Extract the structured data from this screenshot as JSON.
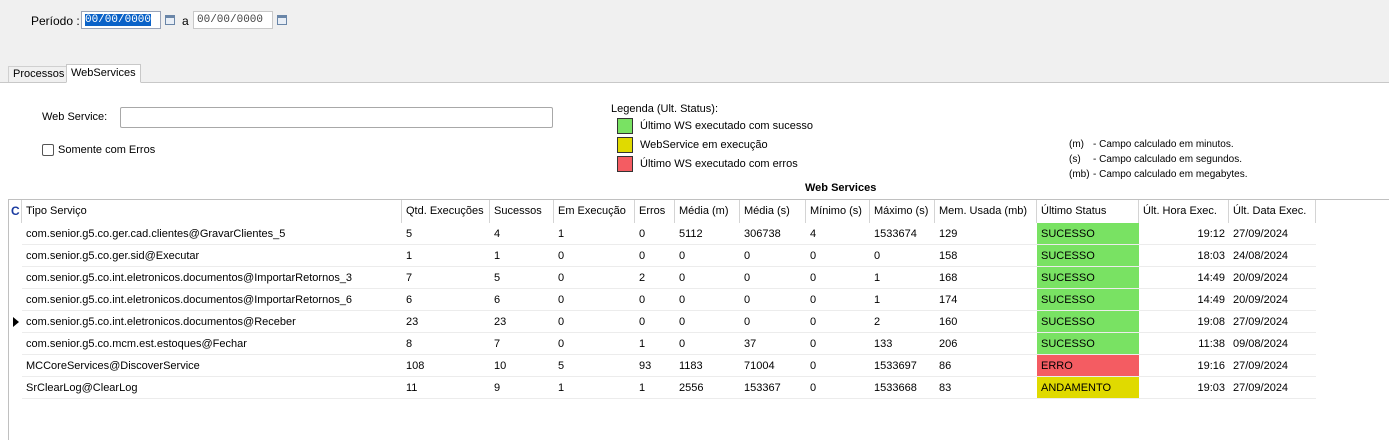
{
  "filter": {
    "period_label": "Período :",
    "date_from": "00/00/0000",
    "separator": "a",
    "date_to": "00/00/0000"
  },
  "tabs": [
    {
      "label": "Processos",
      "active": false
    },
    {
      "label": "WebServices",
      "active": true
    }
  ],
  "form": {
    "web_service_label": "Web Service:",
    "web_service_value": "",
    "only_errors_label": "Somente com Erros",
    "only_errors_checked": false
  },
  "legend": {
    "title": "Legenda (Ult. Status):",
    "items": [
      {
        "label": "Último WS executado com sucesso",
        "color": "#79e263"
      },
      {
        "label": "WebService em execução",
        "color": "#e0da00"
      },
      {
        "label": "Último WS executado com erros",
        "color": "#f45c62"
      }
    ]
  },
  "notes": [
    {
      "unit": "(m)",
      "text": "- Campo calculado em minutos."
    },
    {
      "unit": "(s)",
      "text": "- Campo calculado em segundos."
    },
    {
      "unit": "(mb)",
      "text": "- Campo calculado em megabytes."
    }
  ],
  "grid": {
    "title": "Web Services",
    "corner": "C",
    "columns": [
      "Tipo Serviço",
      "Qtd. Execuções",
      "Sucessos",
      "Em Execução",
      "Erros",
      "Média (m)",
      "Média (s)",
      "Mínimo (s)",
      "Máximo (s)",
      "Mem. Usada (mb)",
      "Último Status",
      "Últ. Hora Exec.",
      "Últ. Data Exec."
    ],
    "status_colors": {
      "SUCESSO": "#79e263",
      "ERRO": "#f45c62",
      "ANDAMENTO": "#e0da00"
    },
    "current_row": 4,
    "rows": [
      [
        "com.senior.g5.co.ger.cad.clientes@GravarClientes_5",
        "5",
        "4",
        "1",
        "0",
        "5112",
        "306738",
        "4",
        "1533674",
        "129",
        "SUCESSO",
        "19:12",
        "27/09/2024"
      ],
      [
        "com.senior.g5.co.ger.sid@Executar",
        "1",
        "1",
        "0",
        "0",
        "0",
        "0",
        "0",
        "0",
        "158",
        "SUCESSO",
        "18:03",
        "24/08/2024"
      ],
      [
        "com.senior.g5.co.int.eletronicos.documentos@ImportarRetornos_3",
        "7",
        "5",
        "0",
        "2",
        "0",
        "0",
        "0",
        "1",
        "168",
        "SUCESSO",
        "14:49",
        "20/09/2024"
      ],
      [
        "com.senior.g5.co.int.eletronicos.documentos@ImportarRetornos_6",
        "6",
        "6",
        "0",
        "0",
        "0",
        "0",
        "0",
        "1",
        "174",
        "SUCESSO",
        "14:49",
        "20/09/2024"
      ],
      [
        "com.senior.g5.co.int.eletronicos.documentos@Receber",
        "23",
        "23",
        "0",
        "0",
        "0",
        "0",
        "0",
        "2",
        "160",
        "SUCESSO",
        "19:08",
        "27/09/2024"
      ],
      [
        "com.senior.g5.co.mcm.est.estoques@Fechar",
        "8",
        "7",
        "0",
        "1",
        "0",
        "37",
        "0",
        "133",
        "206",
        "SUCESSO",
        "11:38",
        "09/08/2024"
      ],
      [
        "MCCoreServices@DiscoverService",
        "108",
        "10",
        "5",
        "93",
        "1183",
        "71004",
        "0",
        "1533697",
        "86",
        "ERRO",
        "19:16",
        "27/09/2024"
      ],
      [
        "SrClearLog@ClearLog",
        "11",
        "9",
        "1",
        "1",
        "2556",
        "153367",
        "0",
        "1533668",
        "83",
        "ANDAMENTO",
        "19:03",
        "27/09/2024"
      ]
    ]
  }
}
